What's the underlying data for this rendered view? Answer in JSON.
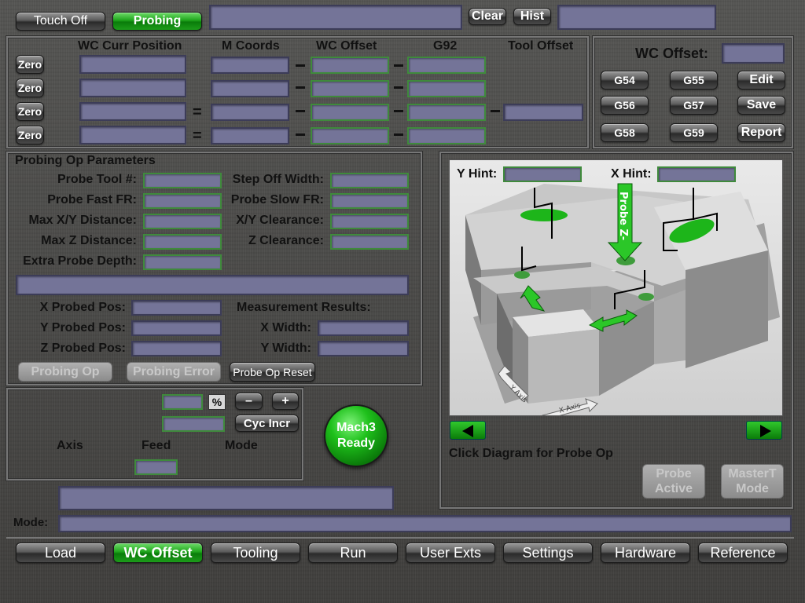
{
  "top": {
    "touch_off": "Touch Off",
    "probing": "Probing",
    "clear": "Clear",
    "hist": "Hist"
  },
  "coords": {
    "headers": [
      "WC Curr Position",
      "M Coords",
      "WC Offset",
      "G92",
      "Tool Offset"
    ],
    "zero_label": "Zero"
  },
  "offsets": {
    "title": "WC Offset:",
    "buttons": [
      "G54",
      "G55",
      "Edit",
      "G56",
      "G57",
      "Save",
      "G58",
      "G59",
      "Report"
    ]
  },
  "params": {
    "title": "Probing Op Parameters",
    "left": [
      "Probe Tool #:",
      "Probe Fast FR:",
      "Max X/Y Distance:",
      "Max Z Distance:",
      "Extra Probe Depth:"
    ],
    "right": [
      "Step Off Width:",
      "Probe Slow FR:",
      "X/Y Clearance:",
      "Z Clearance:"
    ],
    "probed": [
      "X Probed Pos:",
      "Y Probed Pos:",
      "Z Probed Pos:"
    ],
    "results_title": "Measurement Results:",
    "results": [
      "X Width:",
      "Y Width:"
    ],
    "probing_op": "Probing Op",
    "probing_error": "Probing Error",
    "probe_reset": "Probe Op Reset"
  },
  "feed": {
    "percent": "%",
    "minus": "–",
    "plus": "+",
    "cyc_incr": "Cyc Incr",
    "axis": "Axis",
    "feed": "Feed",
    "mode": "Mode",
    "ready_line1": "Mach3",
    "ready_line2": "Ready"
  },
  "diagram": {
    "y_hint": "Y Hint:",
    "x_hint": "X Hint:",
    "probe_z": "Probe Z-",
    "y_axis": "Y Axis",
    "x_axis": "X Axis",
    "caption": "Click Diagram for Probe Op",
    "probe_active_1": "Probe",
    "probe_active_2": "Active",
    "mastert_1": "MasterT",
    "mastert_2": "Mode"
  },
  "mode_label": "Mode:",
  "tabs": [
    "Load",
    "WC Offset",
    "Tooling",
    "Run",
    "User Exts",
    "Settings",
    "Hardware",
    "Reference"
  ],
  "active_tab": "WC Offset",
  "colors": {
    "accent_green": "#1fa51c",
    "dro_fill": "#747498"
  }
}
